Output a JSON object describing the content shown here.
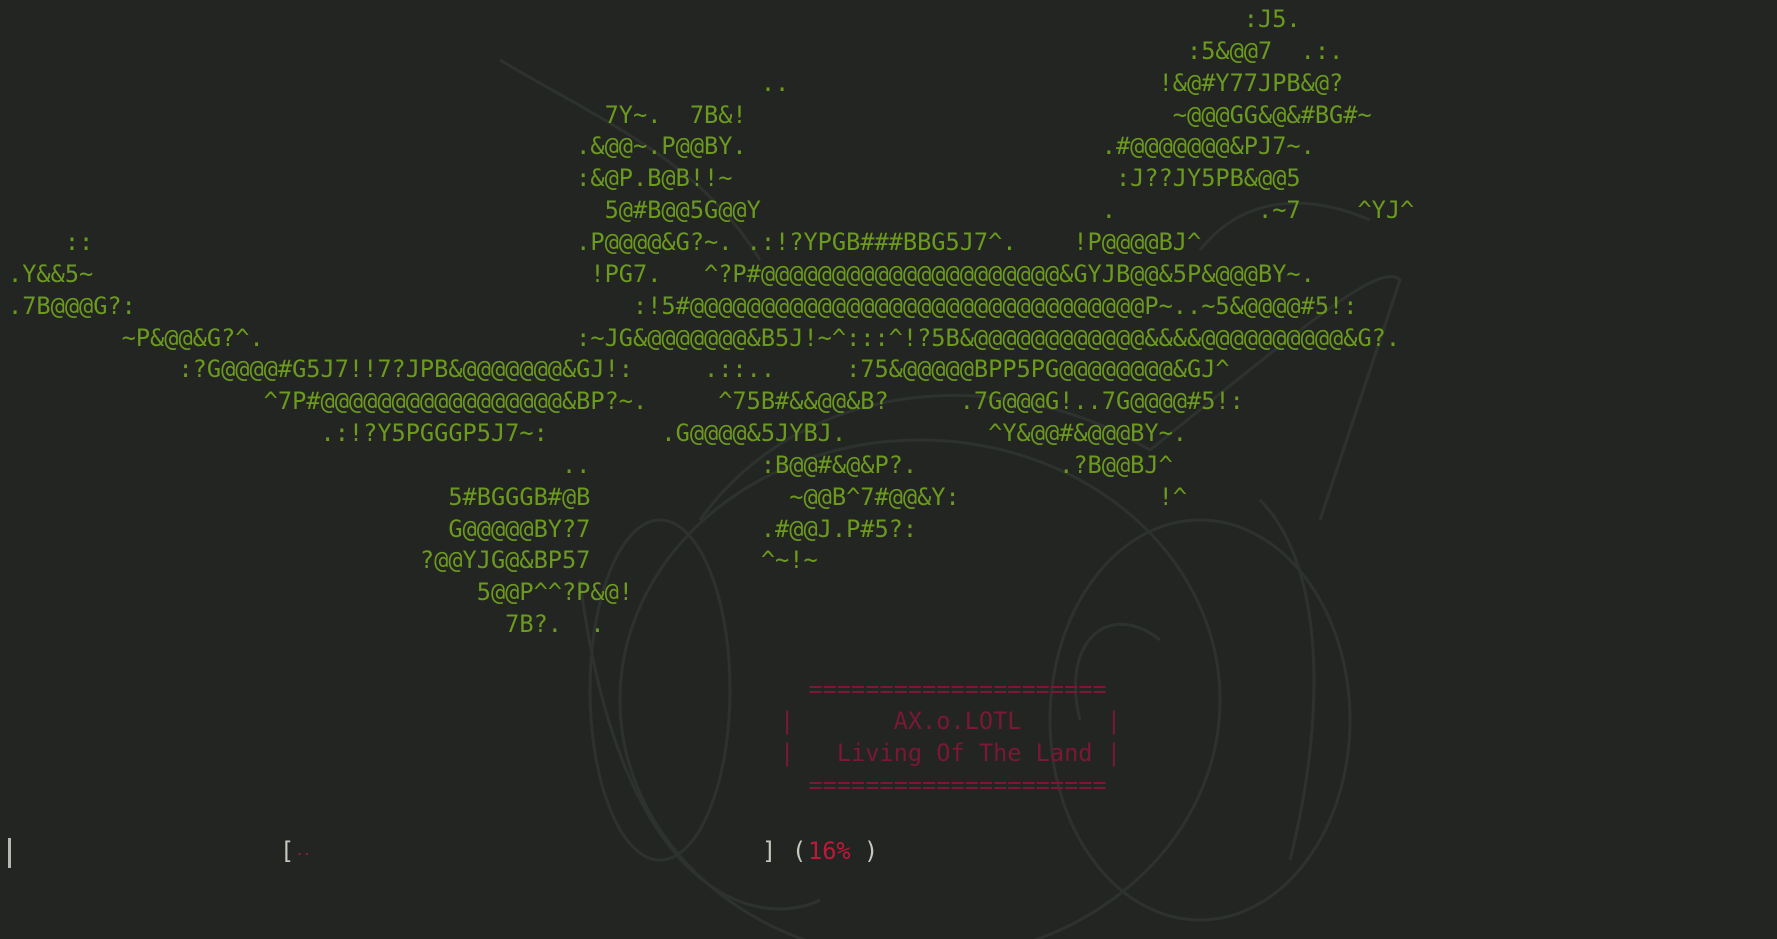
{
  "ascii_art": {
    "lines": [
      "                                                                                       :J5.",
      "                                                                                   :5&@@7  .:.",
      "                                                     ..                          !&@#Y77JPB&@?",
      "                                          7Y~.  7B&!                              ~@@@GG&@&#BG#~",
      "                                        .&@@~.P@@BY.                         .#@@@@@@@&PJ7~.",
      "                                        :&@P.B@B!!~                           :J??JY5PB&@@5",
      "                                          5@#B@@5G@@Y                        .          .~7    ^YJ^",
      "    ::                                  .P@@@@&G?~. .:!?YPGB###BBG5J7^.    !P@@@@BJ^",
      ".Y&&5~                                   !PG7.   ^?P#@@@@@@@@@@@@@@@@@@@@@&GYJB@@&5P&@@@BY~.",
      ".7B@@@G?:                                   :!5#@@@@@@@@@@@@@@@@@@@@@@@@@@@@@@@@P~..~5&@@@@#5!:",
      "        ~P&@@&G?^.                      :~JG&@@@@@@@&B5J!~^:::^!?5B&@@@@@@@@@@@@&&&&@@@@@@@@@@&G?.",
      "            :?G@@@@#G5J7!!7?JPB&@@@@@@@&GJ!:     .::..     :75&@@@@@BPP5PG@@@@@@@@&GJ^",
      "                  ^7P#@@@@@@@@@@@@@@@@@&BP?~.     ^75B#&&@@&B?     .7G@@@G!..7G@@@@#5!:",
      "                      .:!?Y5PGGGP5J7~:        .G@@@@&5JYBJ.          ^Y&@@#&@@@BY~.",
      "                                       ..            :B@@#&@&P?.          .?B@@BJ^",
      "                               5#BGGGB#@B              ~@@B^7#@@&Y:              !^",
      "                               G@@@@@BY?7            .#@@J.P#5?:",
      "                             ?@@YJG@&BP57            ^~!~",
      "                                 5@@P^^?P&@!",
      "                                   7B?.  ."
    ]
  },
  "banner": {
    "lines": [
      "  =====================",
      "|       AX.o.LOTL      |",
      "|   Living Of The Land |",
      "  ====================="
    ]
  },
  "progress": {
    "open_bracket": "[",
    "fill": "..",
    "close_bracket": "]",
    "paren_open": "(",
    "percent": "16%",
    "paren_close": ")",
    "progress_fraction": 0.16
  },
  "colors": {
    "background": "#232522",
    "ascii_art": "#6b9a1e",
    "banner": "#7a1835",
    "progress_accent": "#c0183a",
    "text": "#c8c8c0"
  }
}
